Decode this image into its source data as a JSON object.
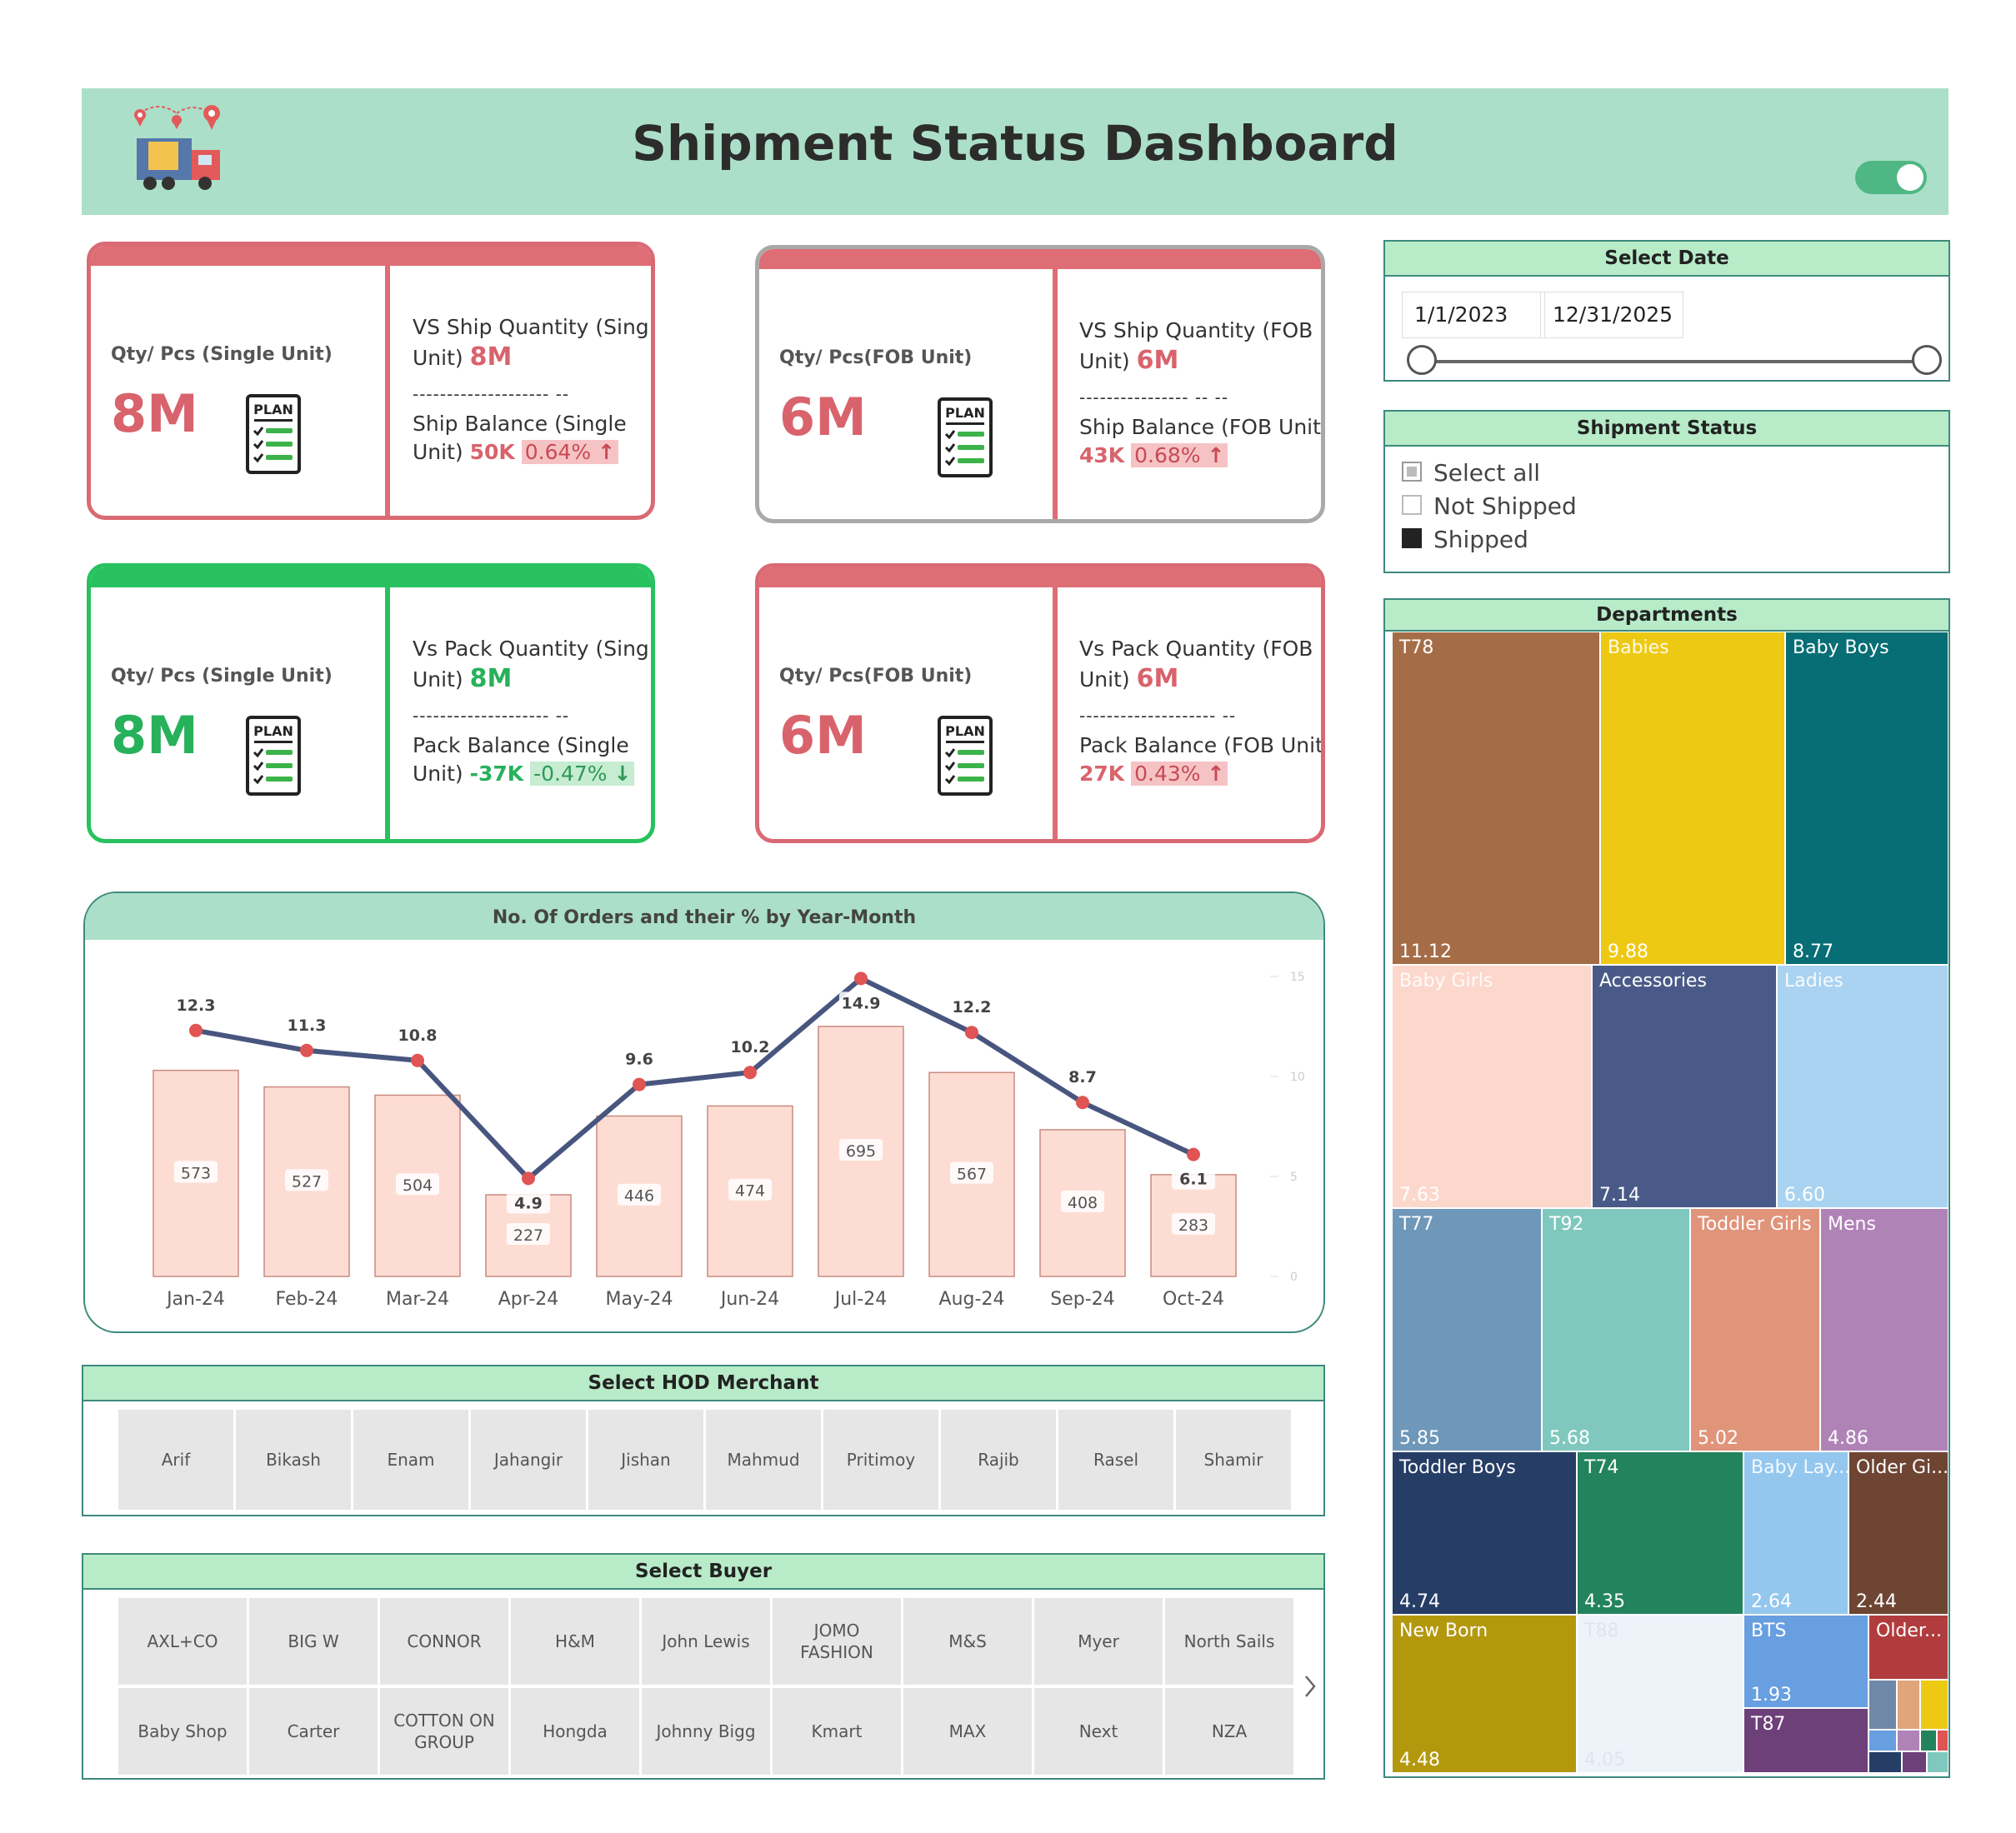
{
  "header": {
    "title": "Shipment Status Dashboard"
  },
  "kpis": {
    "ship_single": {
      "label": "Qty/ Pcs (Single Unit)",
      "value": "8M",
      "plan": "PLAN",
      "vs_line1": "VS Ship Quantity (Single",
      "vs_line2": "Unit)",
      "vs_value": "8M",
      "dash": "-------------------- --",
      "bal_line1": "Ship Balance (Single",
      "bal_line2": "Unit)",
      "bal_value": "50K",
      "bal_pct": "0.64%",
      "arrow": "↑"
    },
    "ship_fob": {
      "label": "Qty/ Pcs(FOB Unit)",
      "value": "6M",
      "plan": "PLAN",
      "vs_line1": "VS Ship Quantity (FOB",
      "vs_line2": "Unit)",
      "vs_value": "6M",
      "dash": "---------------- -- --",
      "bal_line1": "Ship Balance (FOB Unit)",
      "bal_value": "43K",
      "bal_pct": "0.68%",
      "arrow": "↑"
    },
    "pack_single": {
      "label": "Qty/ Pcs (Single Unit)",
      "value": "8M",
      "plan": "PLAN",
      "vs_line1": "Vs Pack Quantity (Single",
      "vs_line2": "Unit)",
      "vs_value": "8M",
      "dash": "-------------------- --",
      "bal_line1": "Pack Balance (Single",
      "bal_line2": "Unit)",
      "bal_value": "-37K",
      "bal_pct": "-0.47%",
      "arrow": "↓"
    },
    "pack_fob": {
      "label": "Qty/ Pcs(FOB Unit)",
      "value": "6M",
      "plan": "PLAN",
      "vs_line1": "Vs Pack Quantity (FOB",
      "vs_line2": "Unit)",
      "vs_value": "6M",
      "dash": "-------------------- --",
      "bal_line1": "Pack Balance (FOB Unit)",
      "bal_value": "27K",
      "bal_pct": "0.43%",
      "arrow": "↑"
    }
  },
  "date_filter": {
    "title": "Select Date",
    "start": "1/1/2023",
    "end": "12/31/2025"
  },
  "shipment_status": {
    "title": "Shipment Status",
    "options": [
      {
        "label": "Select all",
        "state": "partial"
      },
      {
        "label": "Not Shipped",
        "state": "off"
      },
      {
        "label": "Shipped",
        "state": "on"
      }
    ]
  },
  "chart_data": {
    "type": "bar",
    "title": "No. Of Orders and their % by Year-Month",
    "categories": [
      "Jan-24",
      "Feb-24",
      "Mar-24",
      "Apr-24",
      "May-24",
      "Jun-24",
      "Jul-24",
      "Aug-24",
      "Sep-24",
      "Oct-24"
    ],
    "series": [
      {
        "values": [
          573,
          527,
          504,
          227,
          446,
          474,
          695,
          567,
          408,
          283
        ]
      },
      {
        "type": "line",
        "values": [
          12.3,
          11.3,
          10.8,
          4.9,
          9.6,
          10.2,
          14.9,
          12.2,
          8.7,
          6.1
        ]
      }
    ],
    "y2_ticks": [
      "15",
      "10",
      "5",
      "0"
    ],
    "y2lim": [
      0,
      15
    ],
    "grid": false
  },
  "hod": {
    "title": "Select HOD Merchant",
    "names": [
      "Arif",
      "Bikash",
      "Enam",
      "Jahangir",
      "Jishan",
      "Mahmud",
      "Pritimoy",
      "Rajib",
      "Rasel",
      "Shamir"
    ]
  },
  "buyer": {
    "title": "Select Buyer",
    "row1": [
      "AXL+CO",
      "BIG W",
      "CONNOR",
      "H&M",
      "John Lewis",
      "JOMO FASHION",
      "M&S",
      "Myer",
      "North Sails"
    ],
    "row2": [
      "Baby Shop",
      "Carter",
      "COTTON ON GROUP",
      "Hongda",
      "Johnny Bigg",
      "Kmart",
      "MAX",
      "Next",
      "NZA"
    ],
    "next_icon": "chevron-right-icon"
  },
  "departments": {
    "title": "Departments",
    "tiles": [
      {
        "name": "T78",
        "value": "11.12",
        "color": "#a56d47"
      },
      {
        "name": "Babies",
        "value": "9.88",
        "color": "#eec914"
      },
      {
        "name": "Baby Boys",
        "value": "8.77",
        "color": "#066e74"
      },
      {
        "name": "Baby Girls",
        "value": "7.63",
        "color": "#fcd8cc"
      },
      {
        "name": "Accessories",
        "value": "7.14",
        "color": "#4a5a88"
      },
      {
        "name": "Ladies",
        "value": "6.60",
        "color": "#a9d3f0"
      },
      {
        "name": "T77",
        "value": "5.85",
        "color": "#6e97b9"
      },
      {
        "name": "T92",
        "value": "5.68",
        "color": "#80c8bd"
      },
      {
        "name": "Toddler Girls",
        "value": "5.02",
        "color": "#e0947a"
      },
      {
        "name": "Mens",
        "value": "4.86",
        "color": "#b083b7"
      },
      {
        "name": "Toddler Boys",
        "value": "4.74",
        "color": "#263e66"
      },
      {
        "name": "T74",
        "value": "4.35",
        "color": "#23835d"
      },
      {
        "name": "Baby Lay...",
        "value": "2.64",
        "color": "#93c7ee"
      },
      {
        "name": "Older Gi...",
        "value": "2.44",
        "color": "#6d4532"
      },
      {
        "name": "New Born",
        "value": "4.48",
        "color": "#b3980e"
      },
      {
        "name": "T88",
        "value": "4.05",
        "color": "#edf3f9"
      },
      {
        "name": "BTS",
        "value": "1.93",
        "color": "#679fe0"
      },
      {
        "name": "Older...",
        "value": "",
        "color": "#b13c3e"
      },
      {
        "name": "T87",
        "value": "",
        "color": "#6d4079"
      }
    ]
  }
}
